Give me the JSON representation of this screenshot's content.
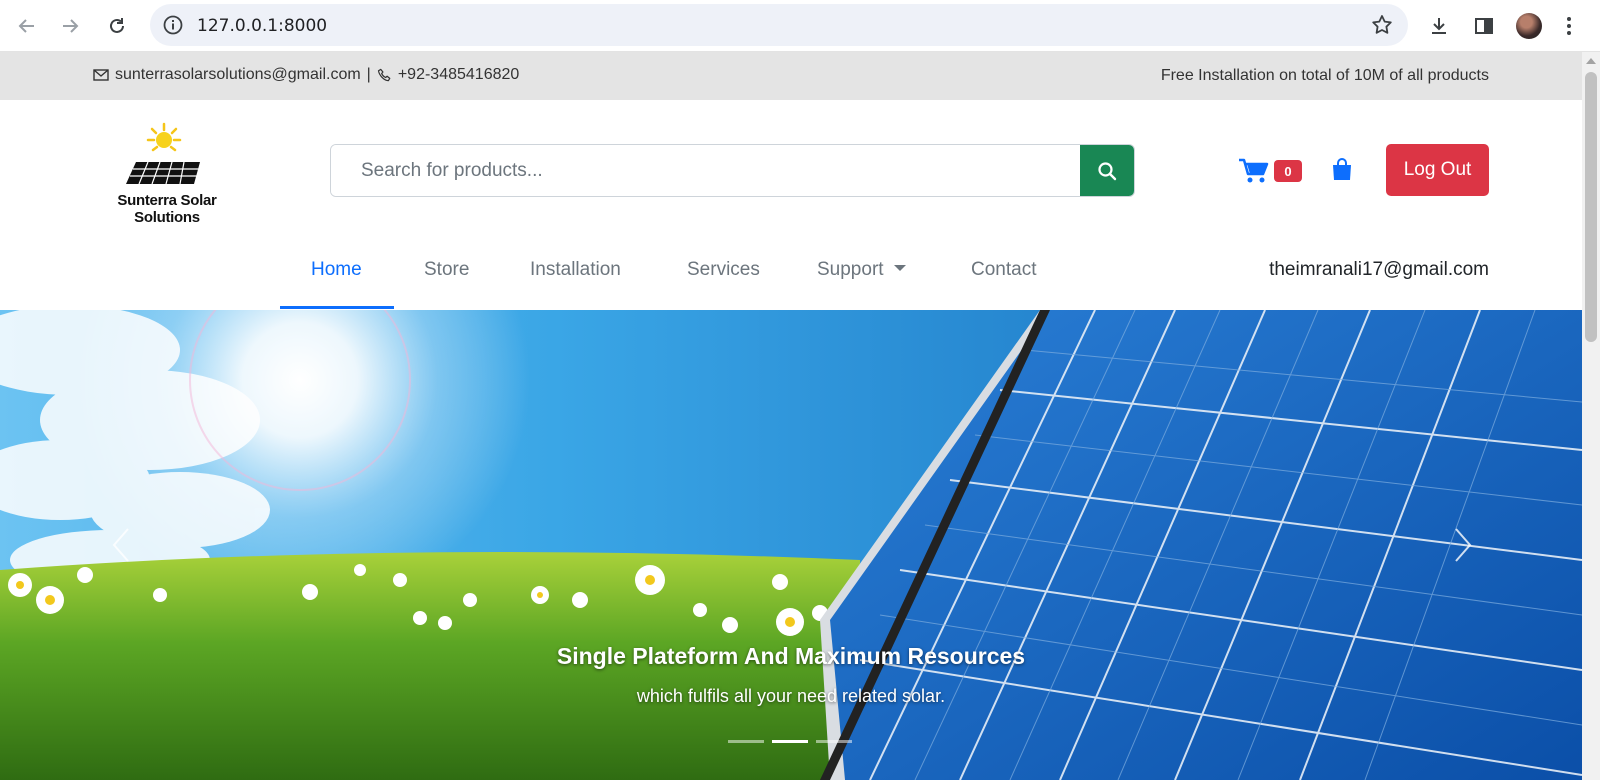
{
  "browser": {
    "url": "127.0.0.1:8000"
  },
  "topbar": {
    "email": "sunterrasolarsolutions@gmail.com",
    "separator": "|",
    "phone": "+92-3485416820",
    "promo": "Free Installation on total of 10M of all products"
  },
  "brand": {
    "name": "Sunterra Solar Solutions"
  },
  "search": {
    "placeholder": "Search for products..."
  },
  "cart": {
    "count": "0"
  },
  "header": {
    "logout_label": "Log Out"
  },
  "nav": {
    "items": [
      "Home",
      "Store",
      "Installation",
      "Services",
      "Support",
      "Contact"
    ],
    "active": "Home",
    "user_email": "theimranali17@gmail.com"
  },
  "hero": {
    "title": "Single Plateform And Maximum Resources",
    "subtitle": "which fulfils all your need related solar.",
    "slide_count": 3,
    "active_slide": 2
  },
  "colors": {
    "accent": "#0d6efd",
    "search_button": "#198754",
    "logout": "#dc3545",
    "topbar_bg": "#e4e4e4"
  }
}
